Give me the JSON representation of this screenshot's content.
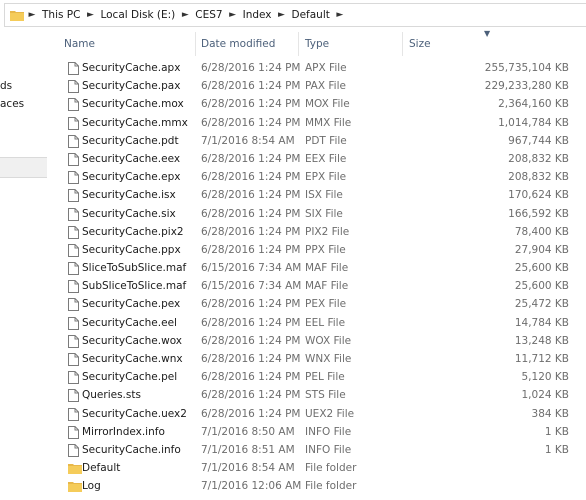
{
  "address": {
    "crumbs": [
      "This PC",
      "Local Disk (E:)",
      "CES7",
      "Index",
      "Default"
    ]
  },
  "nav": {
    "partial_items": [
      "ds",
      "aces"
    ]
  },
  "columns": {
    "name": "Name",
    "date_modified": "Date modified",
    "type": "Type",
    "size": "Size"
  },
  "files": [
    {
      "name": "SecurityCache.apx",
      "date": "6/28/2016 1:24 PM",
      "type": "APX File",
      "size": "255,735,104 KB",
      "kind": "file"
    },
    {
      "name": "SecurityCache.pax",
      "date": "6/28/2016 1:24 PM",
      "type": "PAX File",
      "size": "229,233,280 KB",
      "kind": "file"
    },
    {
      "name": "SecurityCache.mox",
      "date": "6/28/2016 1:24 PM",
      "type": "MOX File",
      "size": "2,364,160 KB",
      "kind": "file"
    },
    {
      "name": "SecurityCache.mmx",
      "date": "6/28/2016 1:24 PM",
      "type": "MMX File",
      "size": "1,014,784 KB",
      "kind": "file"
    },
    {
      "name": "SecurityCache.pdt",
      "date": "7/1/2016 8:54 AM",
      "type": "PDT File",
      "size": "967,744 KB",
      "kind": "file"
    },
    {
      "name": "SecurityCache.eex",
      "date": "6/28/2016 1:24 PM",
      "type": "EEX File",
      "size": "208,832 KB",
      "kind": "file"
    },
    {
      "name": "SecurityCache.epx",
      "date": "6/28/2016 1:24 PM",
      "type": "EPX File",
      "size": "208,832 KB",
      "kind": "file"
    },
    {
      "name": "SecurityCache.isx",
      "date": "6/28/2016 1:24 PM",
      "type": "ISX File",
      "size": "170,624 KB",
      "kind": "file"
    },
    {
      "name": "SecurityCache.six",
      "date": "6/28/2016 1:24 PM",
      "type": "SIX File",
      "size": "166,592 KB",
      "kind": "file"
    },
    {
      "name": "SecurityCache.pix2",
      "date": "6/28/2016 1:24 PM",
      "type": "PIX2 File",
      "size": "78,400 KB",
      "kind": "file"
    },
    {
      "name": "SecurityCache.ppx",
      "date": "6/28/2016 1:24 PM",
      "type": "PPX File",
      "size": "27,904 KB",
      "kind": "file"
    },
    {
      "name": "SliceToSubSlice.maf",
      "date": "6/15/2016 7:34 AM",
      "type": "MAF File",
      "size": "25,600 KB",
      "kind": "file"
    },
    {
      "name": "SubSliceToSlice.maf",
      "date": "6/15/2016 7:34 AM",
      "type": "MAF File",
      "size": "25,600 KB",
      "kind": "file"
    },
    {
      "name": "SecurityCache.pex",
      "date": "6/28/2016 1:24 PM",
      "type": "PEX File",
      "size": "25,472 KB",
      "kind": "file"
    },
    {
      "name": "SecurityCache.eel",
      "date": "6/28/2016 1:24 PM",
      "type": "EEL File",
      "size": "14,784 KB",
      "kind": "file"
    },
    {
      "name": "SecurityCache.wox",
      "date": "6/28/2016 1:24 PM",
      "type": "WOX File",
      "size": "13,248 KB",
      "kind": "file"
    },
    {
      "name": "SecurityCache.wnx",
      "date": "6/28/2016 1:24 PM",
      "type": "WNX File",
      "size": "11,712 KB",
      "kind": "file"
    },
    {
      "name": "SecurityCache.pel",
      "date": "6/28/2016 1:24 PM",
      "type": "PEL File",
      "size": "5,120 KB",
      "kind": "file"
    },
    {
      "name": "Queries.sts",
      "date": "6/28/2016 1:24 PM",
      "type": "STS File",
      "size": "1,024 KB",
      "kind": "file"
    },
    {
      "name": "SecurityCache.uex2",
      "date": "6/28/2016 1:24 PM",
      "type": "UEX2 File",
      "size": "384 KB",
      "kind": "file"
    },
    {
      "name": "MirrorIndex.info",
      "date": "7/1/2016 8:50 AM",
      "type": "INFO File",
      "size": "1 KB",
      "kind": "file"
    },
    {
      "name": "SecurityCache.info",
      "date": "7/1/2016 8:51 AM",
      "type": "INFO File",
      "size": "1 KB",
      "kind": "file"
    },
    {
      "name": "Default",
      "date": "7/1/2016 8:54 AM",
      "type": "File folder",
      "size": "",
      "kind": "folder"
    },
    {
      "name": "Log",
      "date": "7/1/2016 12:06 AM",
      "type": "File folder",
      "size": "",
      "kind": "folder"
    }
  ],
  "colors": {
    "header_text": "#4c607a",
    "folder_yellow": "#e8b84a",
    "secondary_text": "#6d6d6d"
  }
}
